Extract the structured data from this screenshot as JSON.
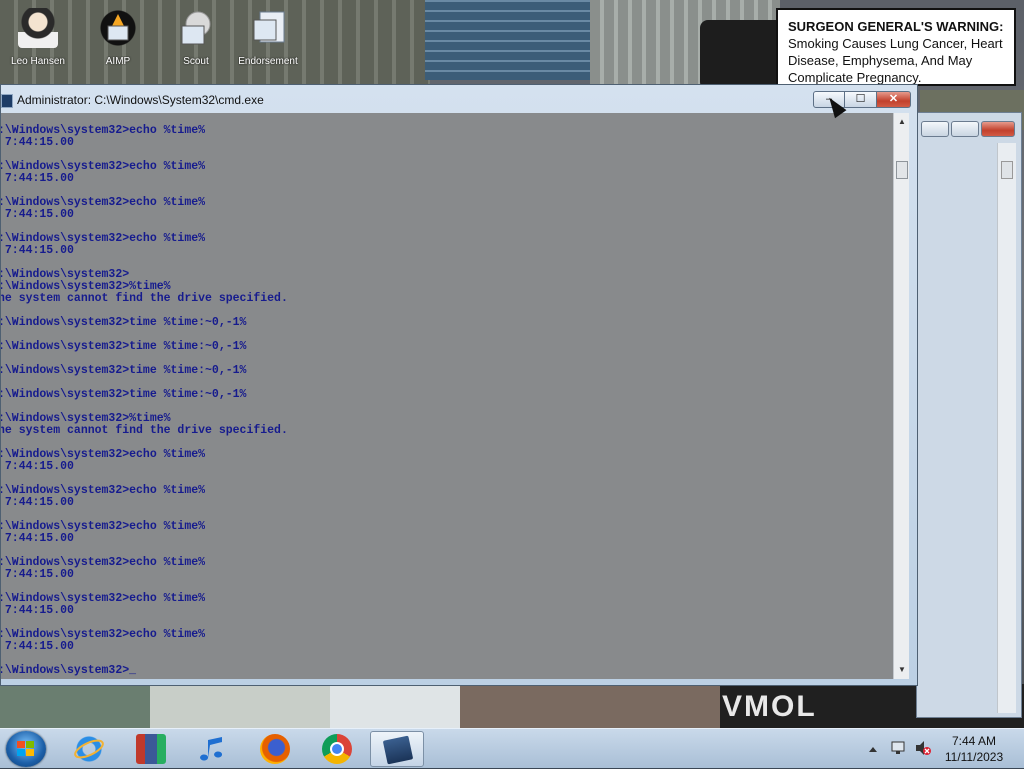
{
  "desktop": {
    "icons": [
      {
        "label": "Leo Hansen",
        "color": "#f2f2f2"
      },
      {
        "label": "AIMP",
        "color": "#111111"
      },
      {
        "label": "Scout",
        "color": "#d9d9d9"
      },
      {
        "label": "Endorsement",
        "color": "#c8d6e8"
      }
    ],
    "warning": {
      "heading": "SURGEON GENERAL'S WARNING:",
      "body": "Smoking Causes Lung Cancer, Heart Disease, Emphysema, And May Complicate Pregnancy."
    },
    "wallpaper_text": "VMOL"
  },
  "cmd_window": {
    "title": "Administrator: C:\\Windows\\System32\\cmd.exe",
    "buttons": {
      "minimize": "–",
      "maximize": "☐",
      "close": "✕"
    },
    "console_lines": [
      ":\\Windows\\system32>echo %time%",
      " 7:44:15.00",
      "",
      ":\\Windows\\system32>echo %time%",
      " 7:44:15.00",
      "",
      ":\\Windows\\system32>echo %time%",
      " 7:44:15.00",
      "",
      ":\\Windows\\system32>echo %time%",
      " 7:44:15.00",
      "",
      ":\\Windows\\system32>",
      ":\\Windows\\system32>%time%",
      "he system cannot find the drive specified.",
      "",
      ":\\Windows\\system32>time %time:~0,-1%",
      "",
      ":\\Windows\\system32>time %time:~0,-1%",
      "",
      ":\\Windows\\system32>time %time:~0,-1%",
      "",
      ":\\Windows\\system32>time %time:~0,-1%",
      "",
      ":\\Windows\\system32>%time%",
      "he system cannot find the drive specified.",
      "",
      ":\\Windows\\system32>echo %time%",
      " 7:44:15.00",
      "",
      ":\\Windows\\system32>echo %time%",
      " 7:44:15.00",
      "",
      ":\\Windows\\system32>echo %time%",
      " 7:44:15.00",
      "",
      ":\\Windows\\system32>echo %time%",
      " 7:44:15.00",
      "",
      ":\\Windows\\system32>echo %time%",
      " 7:44:15.00",
      "",
      ":\\Windows\\system32>echo %time%",
      " 7:44:15.00",
      "",
      ":\\Windows\\system32>_"
    ],
    "colors": {
      "background": "#888a8c",
      "text": "#161b8e"
    }
  },
  "taskbar": {
    "items": [
      {
        "name": "internet-explorer",
        "icon": "ie-icon",
        "color": "#2a8ee6"
      },
      {
        "name": "archive-app",
        "icon": "archive-icon",
        "color": "#c0392b"
      },
      {
        "name": "music-player",
        "icon": "music-note-icon",
        "color": "#1f6fd1"
      },
      {
        "name": "firefox",
        "icon": "firefox-icon",
        "color": "#e66000"
      },
      {
        "name": "chrome",
        "icon": "chrome-icon",
        "color": "#4285f4"
      },
      {
        "name": "command-prompt",
        "icon": "cmd-icon",
        "color": "#2b4d7a"
      }
    ],
    "clock": {
      "time": "7:44 AM",
      "date": "11/11/2023"
    }
  }
}
